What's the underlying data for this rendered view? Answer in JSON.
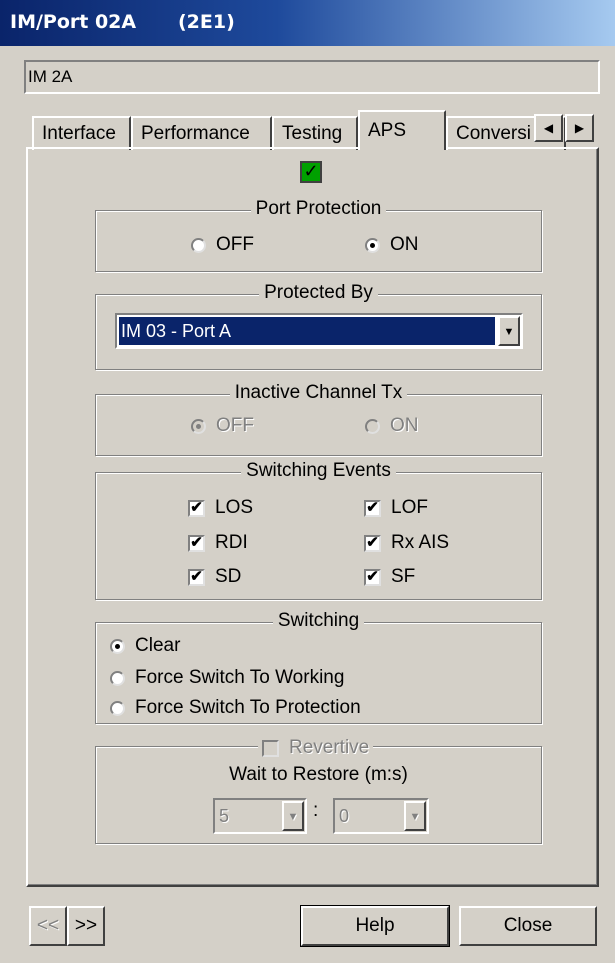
{
  "window": {
    "title": "IM/Port 02A",
    "code": "(2E1)"
  },
  "name_field": {
    "value": "IM 2A"
  },
  "tabs": [
    {
      "label": "Interface"
    },
    {
      "label": "Performance"
    },
    {
      "label": "Testing"
    },
    {
      "label": "APS",
      "active": true
    },
    {
      "label": "Conversi"
    }
  ],
  "tab_scroll": {
    "left_glyph": "◀",
    "right_glyph": "▶"
  },
  "aps_enable": {
    "checked": true,
    "glyph": "✓",
    "color": "#00a000"
  },
  "port_protection": {
    "title": "Port Protection",
    "off": "OFF",
    "on": "ON",
    "selected": "ON"
  },
  "protected_by": {
    "title": "Protected By",
    "value": "IM 03 - Port A",
    "arrow": "▼"
  },
  "inactive_channel": {
    "title": "Inactive Channel Tx",
    "off": "OFF",
    "on": "ON",
    "selected": "OFF",
    "enabled": false
  },
  "switching_events": {
    "title": "Switching Events",
    "items": [
      {
        "label": "LOS",
        "checked": true
      },
      {
        "label": "LOF",
        "checked": true
      },
      {
        "label": "RDI",
        "checked": true
      },
      {
        "label": "Rx AIS",
        "checked": true
      },
      {
        "label": "SD",
        "checked": true
      },
      {
        "label": "SF",
        "checked": true
      }
    ],
    "check_glyph": "✔"
  },
  "switching": {
    "title": "Switching",
    "options": [
      "Clear",
      "Force Switch To Working",
      "Force Switch To Protection"
    ],
    "selected": "Clear"
  },
  "revertive": {
    "label": "Revertive",
    "checked": false,
    "enabled": false,
    "wait_label": "Wait to Restore (m:s)",
    "minutes": "5",
    "separator": ":",
    "seconds": "0",
    "arrow": "▼"
  },
  "nav": {
    "prev": "<<",
    "next": ">>"
  },
  "buttons": {
    "help": "Help",
    "close": "Close"
  },
  "colors": {
    "titlebar": "#0a246a",
    "selection": "#0a246a",
    "face": "#d4d0c8"
  }
}
